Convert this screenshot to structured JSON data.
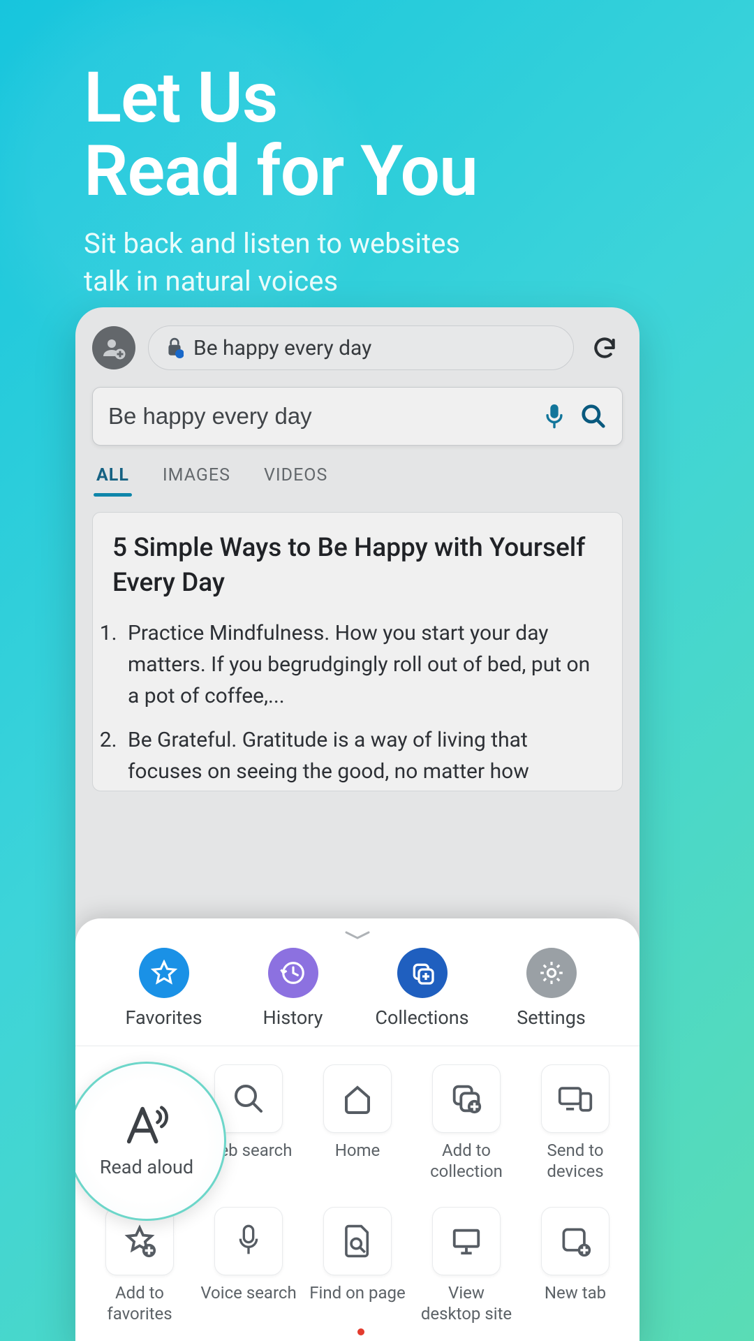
{
  "hero": {
    "title_line1": "Let Us",
    "title_line2": "Read for You",
    "subtitle_line1": "Sit back and listen to websites",
    "subtitle_line2": "talk in natural voices"
  },
  "browser": {
    "address_text": "Be happy every day",
    "search_value": "Be happy every day",
    "tabs": {
      "all": "ALL",
      "images": "IMAGES",
      "videos": "VIDEOS"
    },
    "result": {
      "title": "5 Simple Ways to Be Happy with Yourself Every Day",
      "item1": "Practice Mindfulness. How you start your day matters. If you begrudgingly roll out of bed, put on a pot of coffee,...",
      "item2": "Be Grateful. Gratitude is a way of living that focuses on seeing the good, no matter how"
    }
  },
  "sheet": {
    "top": {
      "favorites": "Favorites",
      "history": "History",
      "collections": "Collections",
      "settings": "Settings"
    },
    "grid": {
      "read_aloud": "Read aloud",
      "web_search": "Web search",
      "home": "Home",
      "add_collection": "Add to collection",
      "send_devices": "Send to devices",
      "add_favorites": "Add to favorites",
      "voice_search": "Voice search",
      "find_on_page": "Find on page",
      "view_desktop": "View desktop site",
      "new_tab": "New tab"
    }
  }
}
